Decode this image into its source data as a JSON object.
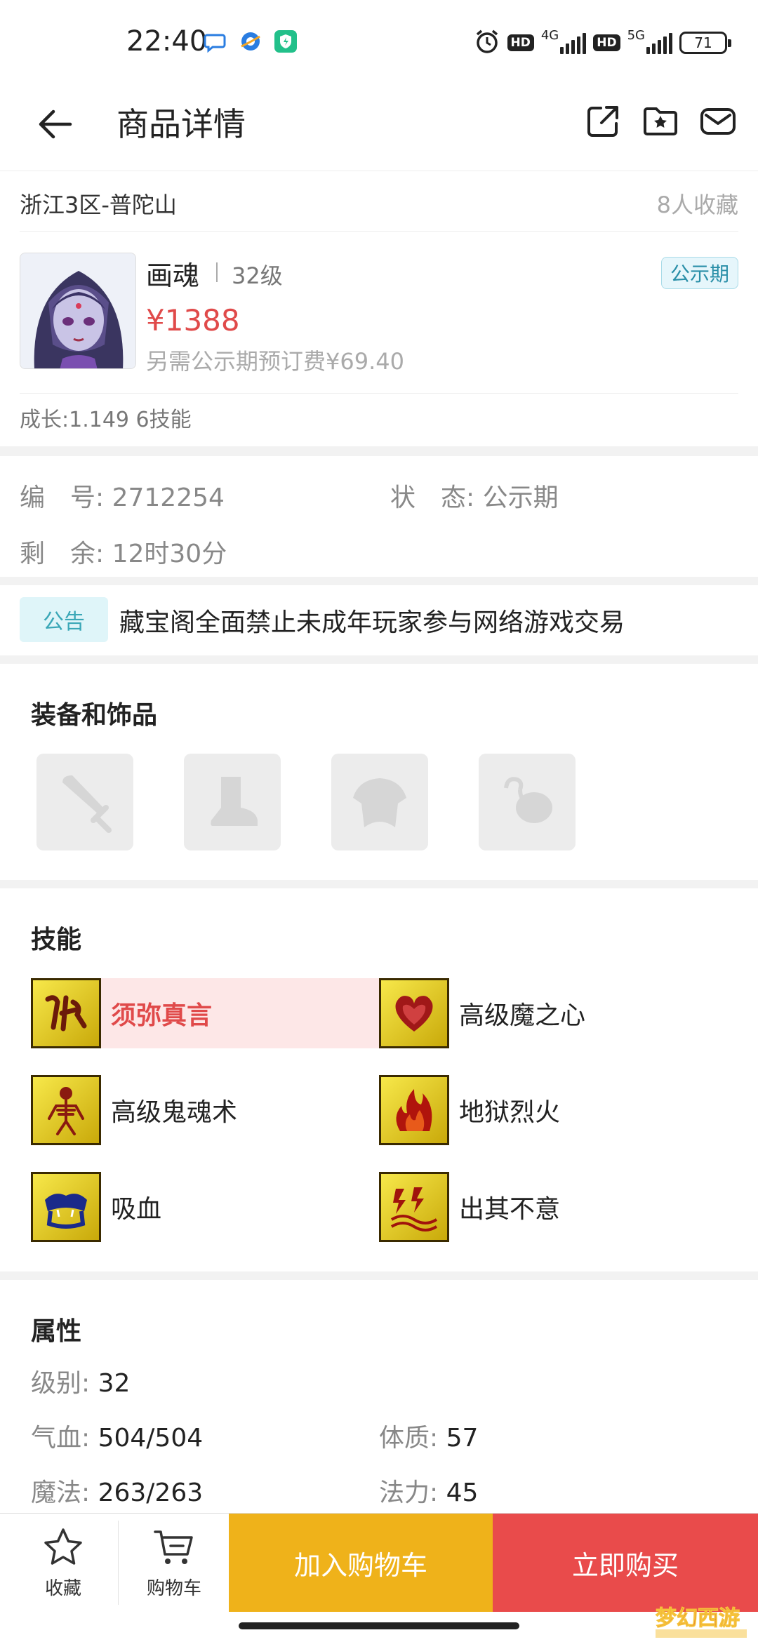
{
  "status_bar": {
    "time": "22:40",
    "network1": "4G",
    "network2": "5G",
    "hd": "HD",
    "battery": "71"
  },
  "header": {
    "title": "商品详情"
  },
  "server": {
    "name": "浙江3区-普陀山",
    "favorites": "8人收藏"
  },
  "product": {
    "name": "画魂",
    "level": "32级",
    "status_tag": "公示期",
    "price": "¥1388",
    "deposit": "另需公示期预订费¥69.40",
    "growth": "成长:1.149 6技能"
  },
  "info": {
    "id_label": "编　号:",
    "id_value": "2712254",
    "state_label": "状　态:",
    "state_value": "公示期",
    "remain_label": "剩　余:",
    "remain_value": "12时30分"
  },
  "notice": {
    "tag": "公告",
    "text": "藏宝阁全面禁止未成年玩家参与网络游戏交易"
  },
  "equipment": {
    "title": "装备和饰品",
    "slots": [
      "sword-icon",
      "boot-icon",
      "armor-icon",
      "ornament-icon"
    ]
  },
  "skills": {
    "title": "技能",
    "items": [
      {
        "name": "须弥真言",
        "icon": "rune-icon"
      },
      {
        "name": "高级魔之心",
        "icon": "heart-icon"
      },
      {
        "name": "高级鬼魂术",
        "icon": "skeleton-icon"
      },
      {
        "name": "地狱烈火",
        "icon": "fire-icon"
      },
      {
        "name": "吸血",
        "icon": "vampire-icon"
      },
      {
        "name": "出其不意",
        "icon": "lightning-icon"
      }
    ]
  },
  "attributes": {
    "title": "属性",
    "level_label": "级别:",
    "level_value": "32",
    "hp_label": "气血:",
    "hp_value": "504/504",
    "con_label": "体质:",
    "con_value": "57",
    "mp_label": "魔法:",
    "mp_value": "263/263",
    "mag_label": "法力:",
    "mag_value": "45"
  },
  "bottom_bar": {
    "favorite": "收藏",
    "cart": "购物车",
    "add_to_cart": "加入购物车",
    "buy_now": "立即购买"
  },
  "colors": {
    "price_red": "#e04a4a",
    "cart_yellow": "#efb21a",
    "buy_red": "#e94b4b",
    "notice_teal": "#3aa7b7"
  }
}
